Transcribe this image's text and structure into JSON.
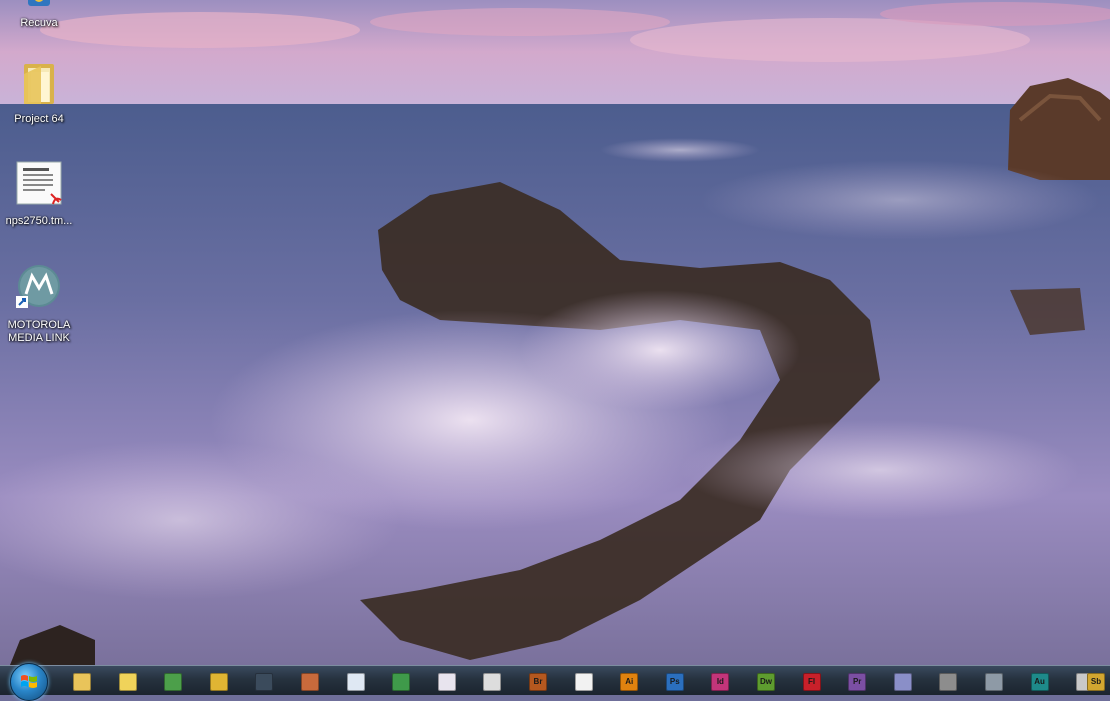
{
  "desktop": {
    "icons": [
      {
        "label": "Recuva",
        "icon": "recuva-icon"
      },
      {
        "label": "Project 64",
        "icon": "folder-icon"
      },
      {
        "label": "nps2750.tm...",
        "icon": "pdf-document-icon"
      },
      {
        "label": "MOTOROLA MEDIA LINK",
        "icon": "motorola-icon"
      }
    ]
  },
  "taskbar": {
    "start": {
      "icon": "windows-start-icon"
    },
    "items": [
      {
        "name": "explorer",
        "icon": "folder-explorer-icon",
        "color": "#e9c45a",
        "text": ""
      },
      {
        "name": "winamp",
        "icon": "lightning-app-icon",
        "color": "#f0d35a",
        "text": ""
      },
      {
        "name": "chrome",
        "icon": "chrome-icon",
        "color": "#4c9f4a",
        "text": ""
      },
      {
        "name": "app-gold",
        "icon": "gold-app-icon",
        "color": "#e0b533",
        "text": ""
      },
      {
        "name": "app-blank",
        "icon": "blank-app-icon",
        "color": "#3b4b5c",
        "text": ""
      },
      {
        "name": "toolbox",
        "icon": "toolbox-icon",
        "color": "#c86a3c",
        "text": ""
      },
      {
        "name": "word",
        "icon": "document-app-icon",
        "color": "#dfe8f3",
        "text": ""
      },
      {
        "name": "excel",
        "icon": "excel-icon",
        "color": "#3f9a4a",
        "text": ""
      },
      {
        "name": "onenote",
        "icon": "notebook-app-icon",
        "color": "#e8e4ee",
        "text": ""
      },
      {
        "name": "app-dark",
        "icon": "dark-app-icon",
        "color": "#dddddd",
        "text": ""
      },
      {
        "name": "bridge",
        "icon": "adobe-bridge-icon",
        "color": "#b5581f",
        "text": "Br"
      },
      {
        "name": "acrobat",
        "icon": "acrobat-icon",
        "color": "#f2f2f2",
        "text": ""
      },
      {
        "name": "illustrator",
        "icon": "illustrator-icon",
        "color": "#e0820f",
        "text": "Ai"
      },
      {
        "name": "photoshop",
        "icon": "photoshop-icon",
        "color": "#2b6fbe",
        "text": "Ps"
      },
      {
        "name": "indesign",
        "icon": "indesign-icon",
        "color": "#c2357a",
        "text": "Id"
      },
      {
        "name": "dreamweaver",
        "icon": "dreamweaver-icon",
        "color": "#5e9c2f",
        "text": "Dw"
      },
      {
        "name": "flash",
        "icon": "flash-icon",
        "color": "#c8202a",
        "text": "Fl"
      },
      {
        "name": "premiere",
        "icon": "premiere-icon",
        "color": "#7b4fa3",
        "text": "Pr"
      },
      {
        "name": "visual-studio",
        "icon": "visual-studio-icon",
        "color": "#8a8fc8",
        "text": ""
      },
      {
        "name": "film-app",
        "icon": "film-app-icon",
        "color": "#8d8d8d",
        "text": ""
      },
      {
        "name": "app-grey",
        "icon": "grey-app-icon",
        "color": "#8e9aa6",
        "text": ""
      },
      {
        "name": "audition",
        "icon": "audition-icon",
        "color": "#1e8a8a",
        "text": "Au"
      },
      {
        "name": "brush-app",
        "icon": "brush-icon",
        "color": "#c9c9c9",
        "text": ""
      },
      {
        "name": "soundbooth",
        "icon": "soundbooth-icon",
        "color": "#d2a630",
        "text": "Sb"
      }
    ]
  }
}
